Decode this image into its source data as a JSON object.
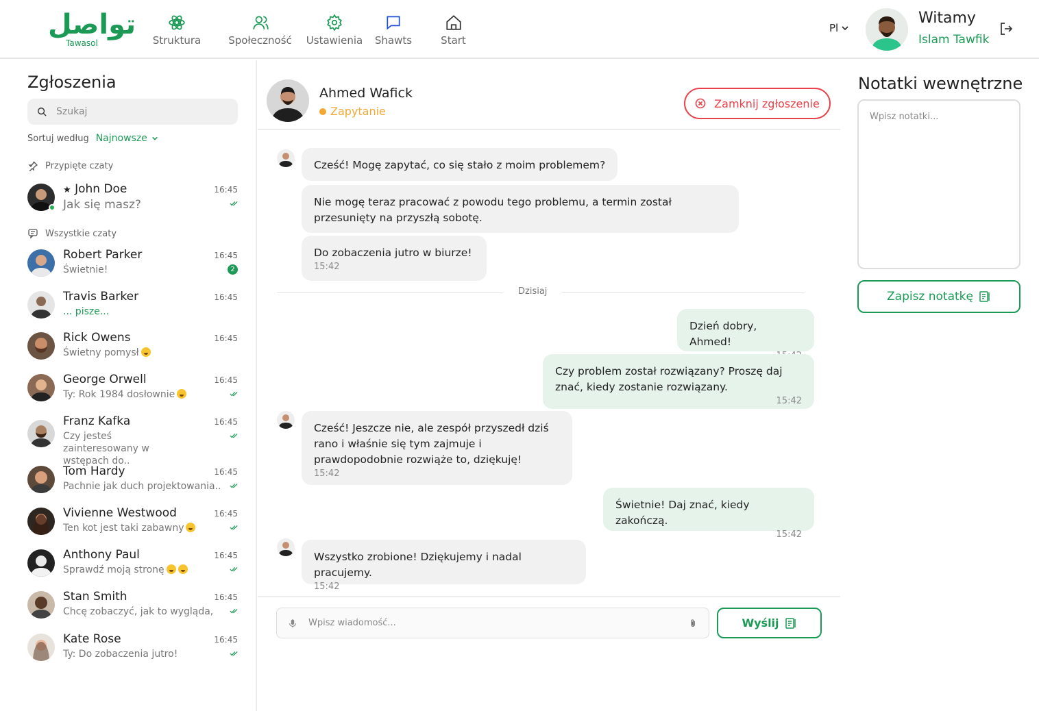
{
  "brand": {
    "logo_mark": "تواصل",
    "logo_text": "Tawasol",
    "accent_color": "#1a9a55",
    "danger_color": "#e8424a",
    "warning_color": "#f2a833"
  },
  "nav": {
    "items": [
      {
        "label": "Struktura",
        "icon": "structure-icon"
      },
      {
        "label": "Społeczność",
        "icon": "community-icon"
      },
      {
        "label": "Ustawienia",
        "icon": "settings-icon"
      },
      {
        "label": "Shawts",
        "icon": "chat-icon"
      },
      {
        "label": "Start",
        "icon": "home-icon"
      }
    ]
  },
  "header": {
    "language": "Pl",
    "welcome": "Witamy",
    "user_name": "Islam Tawfik"
  },
  "sidebar": {
    "title": "Zgłoszenia",
    "search_placeholder": "Szukaj",
    "sort_label": "Sortuj według",
    "sort_value": "Najnowsze",
    "pinned_label": "Przypięte czaty",
    "all_label": "Wszystkie czaty",
    "pinned": [
      {
        "star": "★",
        "name": "John Doe",
        "preview": "Jak się masz?",
        "time": "16:45",
        "read": true,
        "online": true
      }
    ],
    "chats": [
      {
        "name": "Robert Parker",
        "preview": "Świetnie!",
        "time": "16:45",
        "unread": "2"
      },
      {
        "name": "Travis Barker",
        "preview": "... pisze...",
        "time": "16:45",
        "typing": true
      },
      {
        "name": "Rick Owens",
        "preview": "Świetny pomysł",
        "time": "16:45",
        "emoji": "star-struck-emoji"
      },
      {
        "name": "George Orwell",
        "preview": "Ty: Rok 1984 dosłownie",
        "time": "16:45",
        "read": true,
        "emoji": "grinning-emoji"
      },
      {
        "name": "Franz Kafka",
        "preview": "Czy jesteś zainteresowany w wstępach do..",
        "time": "16:45",
        "read": true
      },
      {
        "name": "Tom Hardy",
        "preview": "Pachnie jak duch projektowania..",
        "time": "16:45",
        "read": true
      },
      {
        "name": "Vivienne Westwood",
        "preview": "Ten kot jest taki zabawny",
        "time": "16:45",
        "read": true,
        "emoji": "cat-emoji"
      },
      {
        "name": "Anthony Paul",
        "preview": "Sprawdź moją stronę",
        "time": "16:45",
        "read": true,
        "emoji": "clapping-hands-grinning-emoji"
      },
      {
        "name": "Stan Smith",
        "preview": "Chcę zobaczyć, jak to wygląda,",
        "time": "16:45",
        "read": true
      },
      {
        "name": "Kate Rose",
        "preview": "Ty: Do zobaczenia jutro!",
        "time": "16:45",
        "read": true
      }
    ]
  },
  "conversation": {
    "contact_name": "Ahmed Wafick",
    "status": "Zapytanie",
    "close_label": "Zamknij zgłoszenie",
    "divider_label": "Dzisiaj",
    "messages": [
      {
        "dir": "in",
        "text": "Cześć! Mogę zapytać, co się stało z moim problemem?",
        "time": ""
      },
      {
        "dir": "in",
        "text": "Nie mogę teraz pracować z powodu tego problemu, a termin został przesunięty na przyszłą sobotę.",
        "time": ""
      },
      {
        "dir": "in",
        "text": "Do zobaczenia jutro w biurze!",
        "time": "15:42"
      },
      {
        "dir": "out",
        "text": "Dzień dobry, Ahmed!",
        "time": "15:42"
      },
      {
        "dir": "out",
        "text": "Czy problem został rozwiązany? Proszę daj znać, kiedy zostanie rozwiązany.",
        "time": "15:42"
      },
      {
        "dir": "in",
        "text": "Cześć! Jeszcze nie, ale zespół przyszedł dziś rano i właśnie się tym zajmuje i prawdopodobnie rozwiąże to, dziękuję!",
        "time": "15:42"
      },
      {
        "dir": "out",
        "text": "Świetnie! Daj znać, kiedy zakończą.",
        "time": "15:42"
      },
      {
        "dir": "in",
        "text": "Wszystko zrobione! Dziękujemy i nadal pracujemy.",
        "time": "15:42"
      }
    ],
    "composer_placeholder": "Wpisz wiadomość...",
    "send_label": "Wyślij"
  },
  "notes": {
    "title": "Notatki wewnętrzne",
    "placeholder": "Wpisz notatki...",
    "save_label": "Zapisz notatkę"
  }
}
